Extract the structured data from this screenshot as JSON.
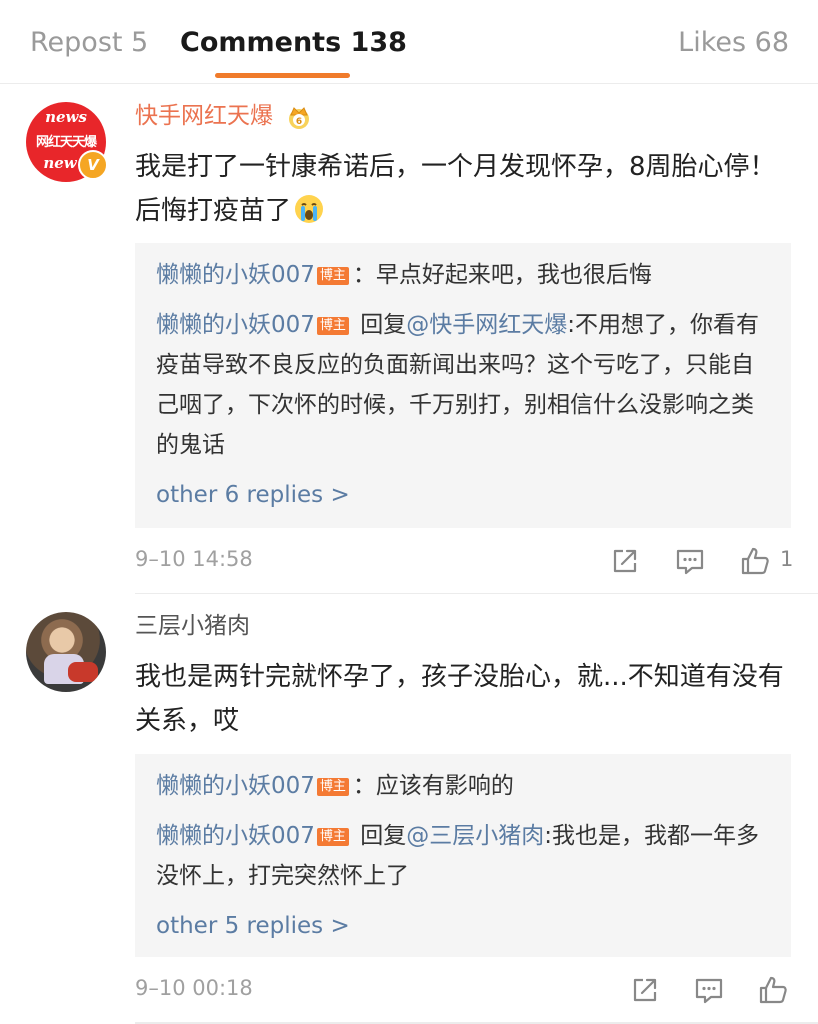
{
  "tabs": {
    "repost": "Repost 5",
    "comments": "Comments 138",
    "likes": "Likes 68"
  },
  "comments": [
    {
      "user": "快手网红天爆",
      "avatar_text_top": "news",
      "avatar_text_center": "网红天天爆",
      "avatar_text_bottom": "new",
      "verified_badge": "V",
      "user_badge_icon": "crown-icon",
      "text": "我是打了一针康希诺后，一个月发现怀孕，8周胎心停！后悔打疫苗了",
      "emoji_icon": "crying-face-icon",
      "replies": [
        {
          "user": "懒懒的小妖007",
          "badge": "博主",
          "text": "：早点好起来吧，我也很后悔"
        },
        {
          "user": "懒懒的小妖007",
          "badge": "博主",
          "prefix": "回复",
          "at": "@快手网红天爆",
          "text": ":不用想了，你看有疫苗导致不良反应的负面新闻出来吗？这个亏吃了，只能自己咽了，下次怀的时候，千万别打，别相信什么没影响之类的鬼话"
        }
      ],
      "more_replies": "other 6 replies >",
      "timestamp": "9–10 14:58",
      "like_count": "1"
    },
    {
      "user": "三层小猪肉",
      "text": "我也是两针完就怀孕了，孩子没胎心，就...不知道有没有关系，哎",
      "replies": [
        {
          "user": "懒懒的小妖007",
          "badge": "博主",
          "text": "：应该有影响的"
        },
        {
          "user": "懒懒的小妖007",
          "badge": "博主",
          "prefix": "回复",
          "at": "@三层小猪肉",
          "text": ":我也是，我都一年多没怀上，打完突然怀上了"
        }
      ],
      "more_replies": "other 5 replies >",
      "timestamp": "9–10 00:18",
      "like_count": ""
    }
  ],
  "colors": {
    "accent": "#f07b2b",
    "vip_name": "#eb7350",
    "link": "#5b7ca3",
    "badge": "#f47a34"
  }
}
